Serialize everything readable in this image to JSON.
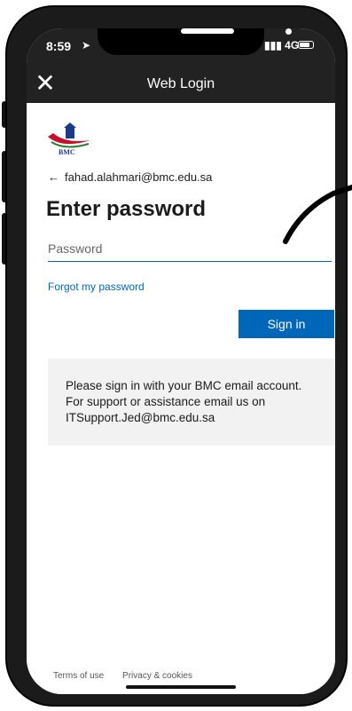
{
  "status": {
    "time": "8:59",
    "network": "4G"
  },
  "nav": {
    "title": "Web Login"
  },
  "login": {
    "email": "fahad.alahmari@bmc.edu.sa",
    "heading": "Enter password",
    "password_placeholder": "Password",
    "forgot_label": "Forgot my password",
    "signin_label": "Sign in",
    "info_text": "Please sign in with your BMC email account. For support or assistance email us on ITSupport.Jed@bmc.edu.sa"
  },
  "logo": {
    "text": "BMC"
  },
  "footer": {
    "terms": "Terms of use",
    "privacy": "Privacy & cookies"
  },
  "colors": {
    "accent": "#0067b8",
    "bar": "#222222"
  }
}
